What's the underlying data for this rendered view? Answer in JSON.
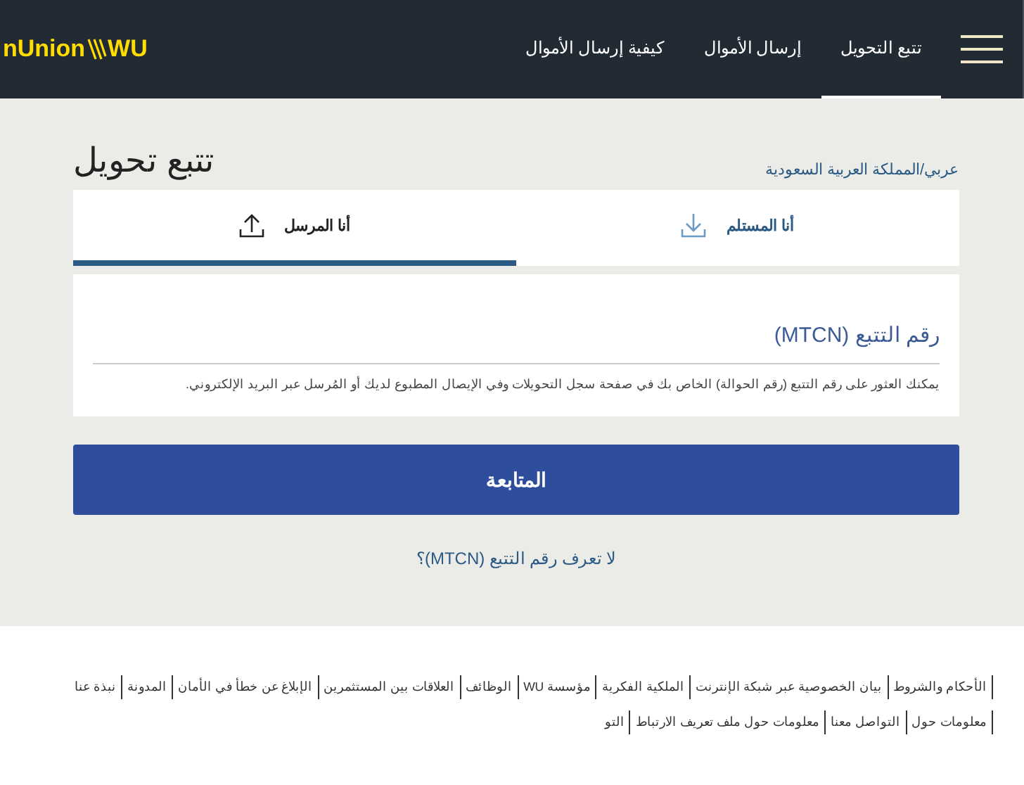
{
  "header": {
    "logo": {
      "text_1": "nUnion",
      "text_2": "WU"
    },
    "nav": [
      {
        "label": "تتبع التحويل",
        "selected": true
      },
      {
        "label": "إرسال الأموال",
        "selected": false
      },
      {
        "label": "كيفية إرسال الأموال",
        "selected": false
      }
    ]
  },
  "page": {
    "locale": "عربي/المملكة العربية السعودية",
    "title": "تتبع تحويل"
  },
  "tabs": [
    {
      "label": "أنا المستلم",
      "kind": "download",
      "selected": false
    },
    {
      "label": "أنا المرسل",
      "kind": "upload",
      "selected": true
    }
  ],
  "form": {
    "placeholder": "رقم التتبع (MTCN)",
    "help": "يمكنك العثور على رقم التتبع (رقم الحوالة) الخاص بك في صفحة سجل التحويلات وفي الإيصال المطبوع لديك أو المُرسل عبر البريد الإلكتروني."
  },
  "continue_button": "المتابعة",
  "help_link": "لا تعرف رقم التتبع (MTCN)؟",
  "footer": {
    "links": [
      "الأحكام والشروط",
      "بيان الخصوصية عبر شبكة الإنترنت",
      "الملكية الفكرية",
      "مؤسسة WU",
      "الوظائف",
      "العلاقات بين المستثمرين",
      "الإبلاغ عن خطأ في الأمان",
      "المدونة",
      "نبذة عنا",
      "معلومات حول",
      "التواصل معنا",
      "معلومات حول ملف تعريف الارتباط",
      "التو"
    ]
  }
}
